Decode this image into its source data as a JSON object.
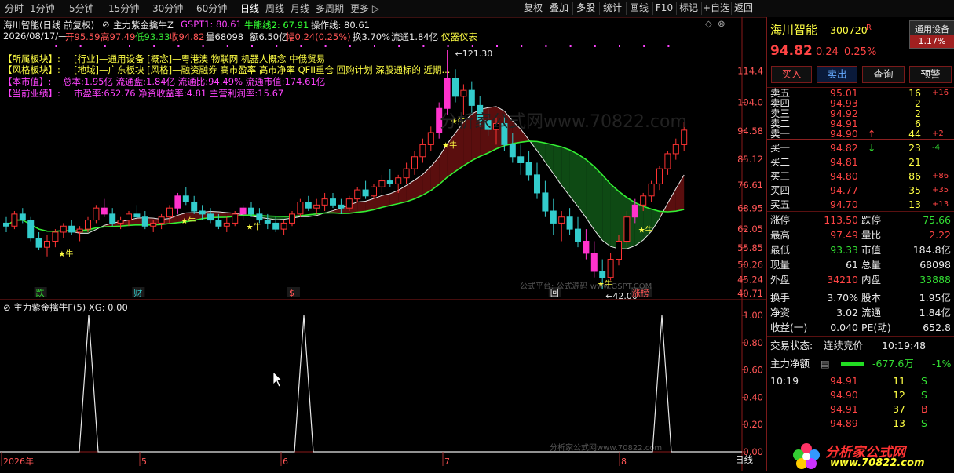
{
  "toolbar": {
    "periods": [
      "分时",
      "1分钟",
      "5分钟",
      "15分钟",
      "30分钟",
      "60分钟",
      "日线",
      "周线",
      "月线",
      "多周期",
      "更多 ▷"
    ],
    "active_period": "日线",
    "right_buttons": [
      "复权",
      "叠加",
      "多股",
      "统计",
      "画线",
      "F10",
      "标记",
      "+自选",
      "返回"
    ]
  },
  "main_chart": {
    "header_left": "海川智能(日线 前复权)",
    "indicator_name": "主力紫金擒牛Z",
    "indicator_values": [
      {
        "label": "GSPT1: 80.61",
        "color": "#ff44ff"
      },
      {
        "label": "牛熊线2: 67.91",
        "color": "#33ff33"
      },
      {
        "label": "操作线: 80.61",
        "color": "#e8e8e8"
      }
    ],
    "ohlc_row": {
      "date": "2026/08/17/—",
      "open": "开95.59",
      "high": "高97.49",
      "low": "低93.33",
      "close": "收94.82",
      "volume": "量68098",
      "amount": "额6.50亿",
      "change": "幅0.24(0.25%)",
      "turnover": "换3.70%",
      "float": "流通1.84亿",
      "meter": "仪器仪表"
    },
    "info_lines": [
      {
        "key": "【所属板块】:",
        "value": "[行业]—通用设备 [概念]—粤港澳 物联网 机器人概念 中俄贸易"
      },
      {
        "key": "【风格板块】:",
        "value": "[地域]—广东板块 [风格]—融资融券 高市盈率 高市净率 QFII重仓 回购计划 深股通标的 近期..."
      },
      {
        "key": "【本市值】:",
        "value": "总本:1.95亿 流通盘:1.84亿 流通比:94.49% 流通市值:174.61亿"
      },
      {
        "key": "【当前业绩】:",
        "value": "市盈率:652.76 净资收益率:4.81 主营利润率:15.67"
      }
    ],
    "price_axis": [
      "114.4",
      "104.0",
      "94.58",
      "85.12",
      "76.61",
      "68.95",
      "62.05",
      "55.85",
      "50.26",
      "45.24",
      "40.71"
    ],
    "high_marker": "121.30",
    "low_marker": "42.00",
    "event_labels": [
      "跌",
      "财",
      "$",
      "回",
      "涨榜"
    ],
    "watermarks": [
      "分析家公式网www.70822.com",
      "公式平台: 公式源码 www.GSPT.COM"
    ]
  },
  "sub_chart": {
    "header": "主力紫金擒牛F(5) XG: 0.00",
    "axis": [
      "1.00",
      "0.80",
      "0.60",
      "0.40",
      "0.20",
      "0.00"
    ],
    "x_labels": [
      "2026年",
      "5",
      "6",
      "7",
      "8"
    ],
    "period_label": "日线",
    "watermark": "分析家公式网www.70822.com"
  },
  "chart_data": {
    "type": "candlestick",
    "ylim": [
      40.71,
      121.3
    ],
    "price_ticks": [
      114.4,
      104.0,
      94.58,
      85.12,
      76.61,
      68.95,
      62.05,
      55.85,
      50.26,
      45.24,
      40.71
    ],
    "candles": [
      [
        64,
        66,
        61,
        63
      ],
      [
        63,
        68,
        62,
        67
      ],
      [
        67,
        69,
        64,
        65
      ],
      [
        65,
        66,
        58,
        59
      ],
      [
        59,
        61,
        55,
        56
      ],
      [
        56,
        60,
        53,
        58
      ],
      [
        58,
        62,
        56,
        61
      ],
      [
        61,
        64,
        59,
        63
      ],
      [
        63,
        65,
        60,
        61
      ],
      [
        61,
        63,
        58,
        62
      ],
      [
        62,
        66,
        61,
        65
      ],
      [
        65,
        70,
        64,
        69
      ],
      [
        69,
        72,
        66,
        67
      ],
      [
        67,
        69,
        63,
        64
      ],
      [
        64,
        66,
        62,
        65
      ],
      [
        65,
        68,
        63,
        67
      ],
      [
        67,
        70,
        65,
        66
      ],
      [
        66,
        68,
        62,
        63
      ],
      [
        63,
        65,
        61,
        64
      ],
      [
        64,
        67,
        62,
        66
      ],
      [
        66,
        70,
        64,
        69
      ],
      [
        69,
        74,
        67,
        73
      ],
      [
        73,
        76,
        70,
        71
      ],
      [
        71,
        73,
        67,
        68
      ],
      [
        68,
        70,
        65,
        67
      ],
      [
        67,
        69,
        64,
        65
      ],
      [
        65,
        67,
        62,
        63
      ],
      [
        63,
        66,
        61,
        64
      ],
      [
        64,
        68,
        63,
        67
      ],
      [
        67,
        70,
        65,
        69
      ],
      [
        69,
        71,
        66,
        67
      ],
      [
        67,
        69,
        64,
        65
      ],
      [
        65,
        67,
        62,
        64
      ],
      [
        64,
        66,
        61,
        62
      ],
      [
        62,
        65,
        60,
        64
      ],
      [
        64,
        68,
        63,
        67
      ],
      [
        67,
        72,
        66,
        71
      ],
      [
        71,
        73,
        68,
        69
      ],
      [
        69,
        72,
        67,
        70
      ],
      [
        70,
        74,
        68,
        72
      ],
      [
        72,
        74,
        69,
        70
      ],
      [
        70,
        72,
        67,
        69
      ],
      [
        69,
        73,
        68,
        72
      ],
      [
        72,
        76,
        71,
        75
      ],
      [
        75,
        78,
        72,
        73
      ],
      [
        73,
        77,
        72,
        76
      ],
      [
        76,
        80,
        74,
        78
      ],
      [
        78,
        82,
        76,
        77
      ],
      [
        77,
        80,
        74,
        79
      ],
      [
        79,
        84,
        77,
        82
      ],
      [
        82,
        88,
        80,
        86
      ],
      [
        86,
        92,
        84,
        90
      ],
      [
        90,
        96,
        88,
        94
      ],
      [
        94,
        104,
        92,
        102
      ],
      [
        102,
        121.3,
        100,
        112
      ],
      [
        112,
        115,
        104,
        106
      ],
      [
        106,
        110,
        100,
        108
      ],
      [
        108,
        111,
        100,
        103
      ],
      [
        103,
        106,
        96,
        98
      ],
      [
        98,
        102,
        93,
        95
      ],
      [
        95,
        99,
        90,
        97
      ],
      [
        97,
        100,
        88,
        90
      ],
      [
        90,
        94,
        84,
        86
      ],
      [
        86,
        90,
        80,
        84
      ],
      [
        84,
        88,
        78,
        80
      ],
      [
        80,
        84,
        72,
        74
      ],
      [
        74,
        78,
        66,
        68
      ],
      [
        68,
        72,
        60,
        64
      ],
      [
        64,
        68,
        58,
        66
      ],
      [
        66,
        69,
        60,
        62
      ],
      [
        62,
        66,
        56,
        58
      ],
      [
        58,
        62,
        52,
        54
      ],
      [
        54,
        58,
        46,
        48
      ],
      [
        48,
        52,
        42,
        46
      ],
      [
        46,
        54,
        45,
        52
      ],
      [
        52,
        60,
        50,
        58
      ],
      [
        58,
        68,
        56,
        66
      ],
      [
        66,
        72,
        64,
        70
      ],
      [
        70,
        74,
        68,
        73
      ],
      [
        73,
        78,
        71,
        77
      ],
      [
        77,
        83,
        75,
        82
      ],
      [
        82,
        88,
        80,
        87
      ],
      [
        87,
        92,
        85,
        90
      ],
      [
        90,
        97.49,
        88,
        94.82
      ]
    ],
    "signal_days": [
      6,
      30,
      67
    ],
    "pink_candle_days": [
      12,
      21,
      29,
      53,
      54,
      71,
      72,
      77
    ]
  },
  "right_panel": {
    "stock_name": "海川智能",
    "stock_code": "300720",
    "badge": "R",
    "sector_name": "通用设备",
    "sector_pct": "1.17%",
    "price": "94.82",
    "change": "0.24",
    "change_pct": "0.25%",
    "buttons": [
      "买入",
      "卖出",
      "查询",
      "预警"
    ],
    "sell_levels": [
      {
        "label": "卖五",
        "price": "95.01",
        "vol": "16",
        "chg": "+16"
      },
      {
        "label": "卖四",
        "price": "94.93",
        "vol": "2",
        "chg": ""
      },
      {
        "label": "卖三",
        "price": "94.92",
        "vol": "2",
        "chg": ""
      },
      {
        "label": "卖二",
        "price": "94.91",
        "vol": "6",
        "chg": ""
      },
      {
        "label": "卖一",
        "price": "94.90",
        "vol": "44",
        "chg": "+2"
      }
    ],
    "buy_levels": [
      {
        "label": "买一",
        "price": "94.82",
        "vol": "23",
        "chg": "-4"
      },
      {
        "label": "买二",
        "price": "94.81",
        "vol": "21",
        "chg": ""
      },
      {
        "label": "买三",
        "price": "94.80",
        "vol": "86",
        "chg": "+86"
      },
      {
        "label": "买四",
        "price": "94.77",
        "vol": "35",
        "chg": "+35"
      },
      {
        "label": "买五",
        "price": "94.70",
        "vol": "13",
        "chg": "+13"
      }
    ],
    "stats": [
      {
        "l1": "涨停",
        "v1": "113.50",
        "c1": "red",
        "l2": "跌停",
        "v2": "75.66",
        "c2": "green"
      },
      {
        "l1": "最高",
        "v1": "97.49",
        "c1": "red",
        "l2": "量比",
        "v2": "2.22",
        "c2": "red"
      },
      {
        "l1": "最低",
        "v1": "93.33",
        "c1": "green",
        "l2": "市值",
        "v2": "184.8亿",
        "c2": "white"
      },
      {
        "l1": "现量",
        "v1": "61",
        "c1": "white",
        "l2": "总量",
        "v2": "68098",
        "c2": "white"
      },
      {
        "l1": "外盘",
        "v1": "34210",
        "c1": "red",
        "l2": "内盘",
        "v2": "33888",
        "c2": "green"
      }
    ],
    "stats2": [
      {
        "l1": "换手",
        "v1": "3.70%",
        "l2": "股本",
        "v2": "1.95亿"
      },
      {
        "l1": "净资",
        "v1": "3.02",
        "l2": "流通",
        "v2": "1.84亿"
      },
      {
        "l1": "收益(一)",
        "v1": "0.040",
        "l2": "PE(动)",
        "v2": "652.8"
      }
    ],
    "trade_state_label": "交易状态:",
    "trade_state": "连续竞价",
    "trade_time": "10:19:48",
    "net_label": "主力净额",
    "net_value": "-677.6万",
    "net_pct": "-1%",
    "ticks": [
      {
        "time": "10:19",
        "price": "94.91",
        "vol": "11",
        "side": "S"
      },
      {
        "time": "",
        "price": "94.90",
        "vol": "12",
        "side": "S"
      },
      {
        "time": "",
        "price": "94.91",
        "vol": "37",
        "side": "B"
      },
      {
        "time": "",
        "price": "94.89",
        "vol": "13",
        "side": "S"
      }
    ],
    "logo_text": "分析家公式网",
    "logo_url": "www.70822.com"
  }
}
